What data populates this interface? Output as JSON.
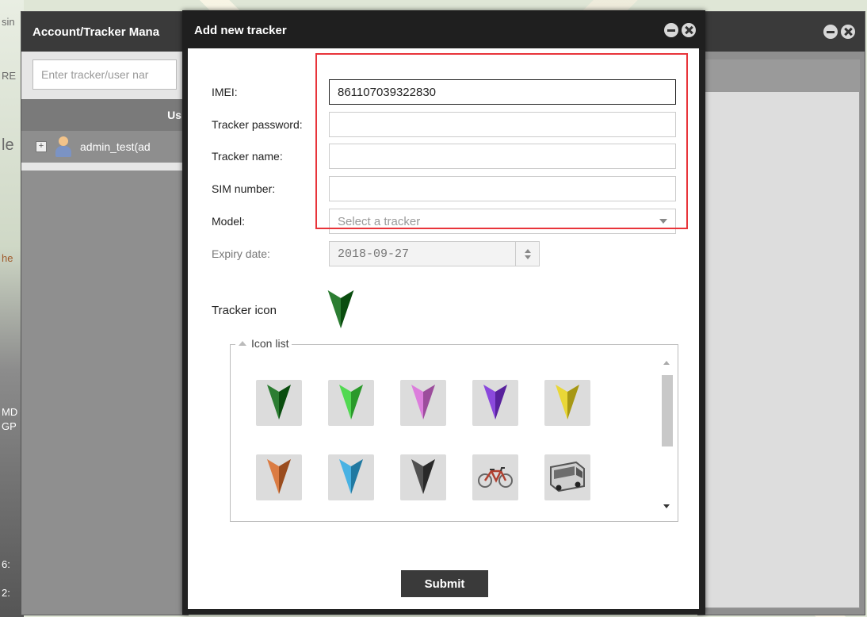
{
  "background": {
    "left_fragments": [
      "sin",
      "RE",
      "le",
      "he",
      "MD",
      "GP",
      "6:",
      "2:"
    ]
  },
  "account_window": {
    "title": "Account/Tracker Mana",
    "search_placeholder": "Enter tracker/user nar",
    "column_header": "Us",
    "row_label": "admin_test(ad",
    "expand_glyph": "+"
  },
  "dialog": {
    "title": "Add new tracker",
    "fields": {
      "imei": {
        "label": "IMEI:",
        "value": "861107039322830"
      },
      "password": {
        "label": "Tracker password:",
        "value": ""
      },
      "name": {
        "label": "Tracker name:",
        "value": ""
      },
      "sim": {
        "label": "SIM number:",
        "value": ""
      },
      "model": {
        "label": "Model:",
        "placeholder": "Select a tracker"
      },
      "expiry": {
        "label": "Expiry date:",
        "value": "2018-09-27"
      }
    },
    "tracker_icon_label": "Tracker icon",
    "icon_list_label": "Icon list",
    "icons": [
      {
        "name": "green-dark-arrow-icon",
        "color": "#0f6b16",
        "kind": "arrow"
      },
      {
        "name": "green-light-arrow-icon",
        "color": "#3bd43b",
        "kind": "arrow"
      },
      {
        "name": "pink-arrow-icon",
        "color": "#d86bd8",
        "kind": "arrow"
      },
      {
        "name": "purple-arrow-icon",
        "color": "#7a2fd8",
        "kind": "arrow"
      },
      {
        "name": "yellow-arrow-icon",
        "color": "#e6d21c",
        "kind": "arrow"
      },
      {
        "name": "orange-arrow-icon",
        "color": "#d66a2a",
        "kind": "arrow"
      },
      {
        "name": "blue-arrow-icon",
        "color": "#2fa8e0",
        "kind": "arrow"
      },
      {
        "name": "black-arrow-icon",
        "color": "#3a3a3a",
        "kind": "arrow"
      },
      {
        "name": "bicycle-icon",
        "color": "#b04030",
        "kind": "bike"
      },
      {
        "name": "bus-icon",
        "color": "#555555",
        "kind": "bus"
      }
    ],
    "selected_icon_color": "#0f6b16",
    "submit_label": "Submit"
  },
  "colors": {
    "highlight": "#e8343a",
    "titlebar": "#1f1f1f"
  }
}
